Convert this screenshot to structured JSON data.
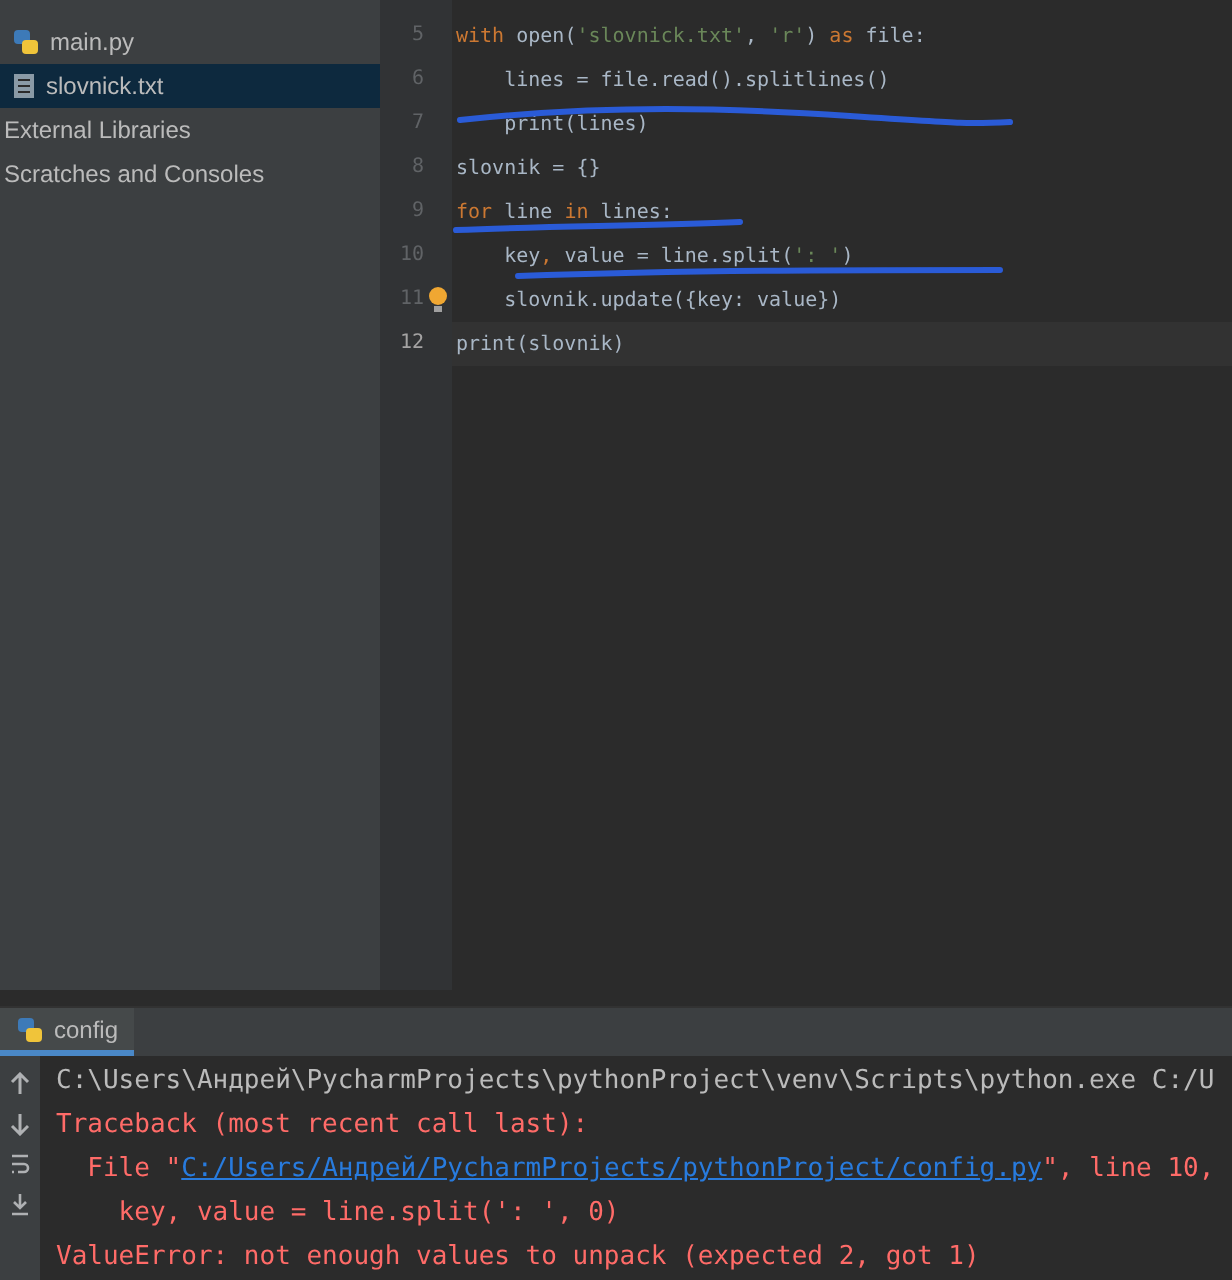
{
  "project_tree": {
    "items": [
      {
        "label": "main.py",
        "kind": "python",
        "selected": false
      },
      {
        "label": "slovnick.txt",
        "kind": "text",
        "selected": true
      },
      {
        "label": "External Libraries",
        "kind": "plain",
        "selected": false
      },
      {
        "label": "Scratches and Consoles",
        "kind": "plain",
        "selected": false
      }
    ]
  },
  "editor": {
    "lines": [
      {
        "number": "5",
        "current": false,
        "bulb": false,
        "tokens": [
          {
            "t": "with ",
            "kind": "keyword"
          },
          {
            "t": "open(",
            "kind": "plain"
          },
          {
            "t": "'slovnick.txt'",
            "kind": "string"
          },
          {
            "t": ", ",
            "kind": "plain"
          },
          {
            "t": "'r'",
            "kind": "string"
          },
          {
            "t": ") ",
            "kind": "plain"
          },
          {
            "t": "as ",
            "kind": "keyword"
          },
          {
            "t": "file:",
            "kind": "plain"
          }
        ]
      },
      {
        "number": "6",
        "current": false,
        "bulb": false,
        "tokens": [
          {
            "t": "    lines = file.read().splitlines()",
            "kind": "plain"
          }
        ]
      },
      {
        "number": "7",
        "current": false,
        "bulb": false,
        "tokens": [
          {
            "t": "    print(lines)",
            "kind": "plain"
          }
        ]
      },
      {
        "number": "8",
        "current": false,
        "bulb": false,
        "tokens": [
          {
            "t": "slovnik = {}",
            "kind": "plain"
          }
        ]
      },
      {
        "number": "9",
        "current": false,
        "bulb": false,
        "tokens": [
          {
            "t": "for ",
            "kind": "keyword"
          },
          {
            "t": "line ",
            "kind": "plain"
          },
          {
            "t": "in ",
            "kind": "keyword"
          },
          {
            "t": "lines:",
            "kind": "plain"
          }
        ]
      },
      {
        "number": "10",
        "current": false,
        "bulb": false,
        "tokens": [
          {
            "t": "    key",
            "kind": "plain"
          },
          {
            "t": ",",
            "kind": "keyword"
          },
          {
            "t": " value = line.split(",
            "kind": "plain"
          },
          {
            "t": "': '",
            "kind": "string"
          },
          {
            "t": ")",
            "kind": "plain"
          }
        ]
      },
      {
        "number": "11",
        "current": false,
        "bulb": true,
        "tokens": [
          {
            "t": "    slovnik.update({key: value})",
            "kind": "plain"
          }
        ]
      },
      {
        "number": "12",
        "current": true,
        "bulb": false,
        "tokens": [
          {
            "t": "print(slovnik)",
            "kind": "plain"
          }
        ]
      }
    ]
  },
  "run_panel": {
    "tab": {
      "label": "config",
      "selected": true
    },
    "lines": [
      {
        "kind": "plain",
        "text": "C:\\Users\\Андрей\\PycharmProjects\\pythonProject\\venv\\Scripts\\python.exe C:/U"
      },
      {
        "kind": "error",
        "text": "Traceback (most recent call last):"
      },
      {
        "kind": "link",
        "prefix": "  File \"",
        "link": "C:/Users/Андрей/PycharmProjects/pythonProject/config.py",
        "suffix": "\", line 10,"
      },
      {
        "kind": "error",
        "text": "    key, value = line.split(': ', 0)"
      },
      {
        "kind": "error",
        "text": "ValueError: not enough values to unpack (expected 2, got 1)"
      }
    ]
  }
}
